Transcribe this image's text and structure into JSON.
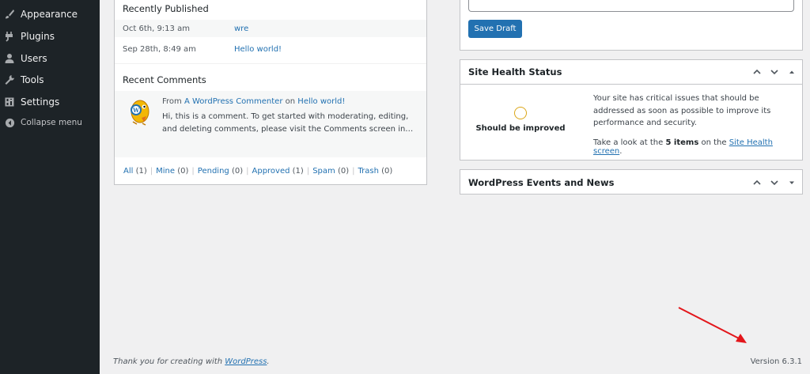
{
  "sidebar": {
    "items": [
      {
        "label": "Appearance",
        "icon": "paintbrush-icon"
      },
      {
        "label": "Plugins",
        "icon": "plugin-icon"
      },
      {
        "label": "Users",
        "icon": "user-icon"
      },
      {
        "label": "Tools",
        "icon": "wrench-icon"
      },
      {
        "label": "Settings",
        "icon": "settings-icon"
      },
      {
        "label": "Collapse menu",
        "icon": "collapse-icon"
      }
    ]
  },
  "activity": {
    "recently_published_title": "Recently Published",
    "posts": [
      {
        "date": "Oct 6th, 9:13 am",
        "title": "wre"
      },
      {
        "date": "Sep 28th, 8:49 am",
        "title": "Hello world!"
      }
    ],
    "recent_comments_title": "Recent Comments",
    "comment": {
      "from_prefix": "From",
      "author": "A WordPress Commenter",
      "on_word": "on",
      "post": "Hello world!",
      "text": "Hi, this is a comment. To get started with moderating, editing, and deleting comments, please visit the Comments screen in…"
    },
    "filters": [
      {
        "label": "All",
        "count": "(1)"
      },
      {
        "label": "Mine",
        "count": "(0)"
      },
      {
        "label": "Pending",
        "count": "(0)"
      },
      {
        "label": "Approved",
        "count": "(1)"
      },
      {
        "label": "Spam",
        "count": "(0)"
      },
      {
        "label": "Trash",
        "count": "(0)"
      }
    ]
  },
  "quick_draft": {
    "save_label": "Save Draft"
  },
  "site_health": {
    "title": "Site Health Status",
    "status": "Should be improved",
    "message": "Your site has critical issues that should be addressed as soon as possible to improve its performance and security.",
    "items_prefix": "Take a look at the",
    "items_count": "5 items",
    "items_middle": "on the",
    "items_link": "Site Health screen",
    "items_suffix": "."
  },
  "events": {
    "title": "WordPress Events and News"
  },
  "footer": {
    "thanks_prefix": "Thank you for creating with",
    "thanks_link": "WordPress",
    "thanks_suffix": ".",
    "version": "Version 6.3.1"
  },
  "colors": {
    "sidebar_bg": "#1d2327",
    "link": "#2271b1",
    "annotation_arrow": "#e3161b"
  }
}
